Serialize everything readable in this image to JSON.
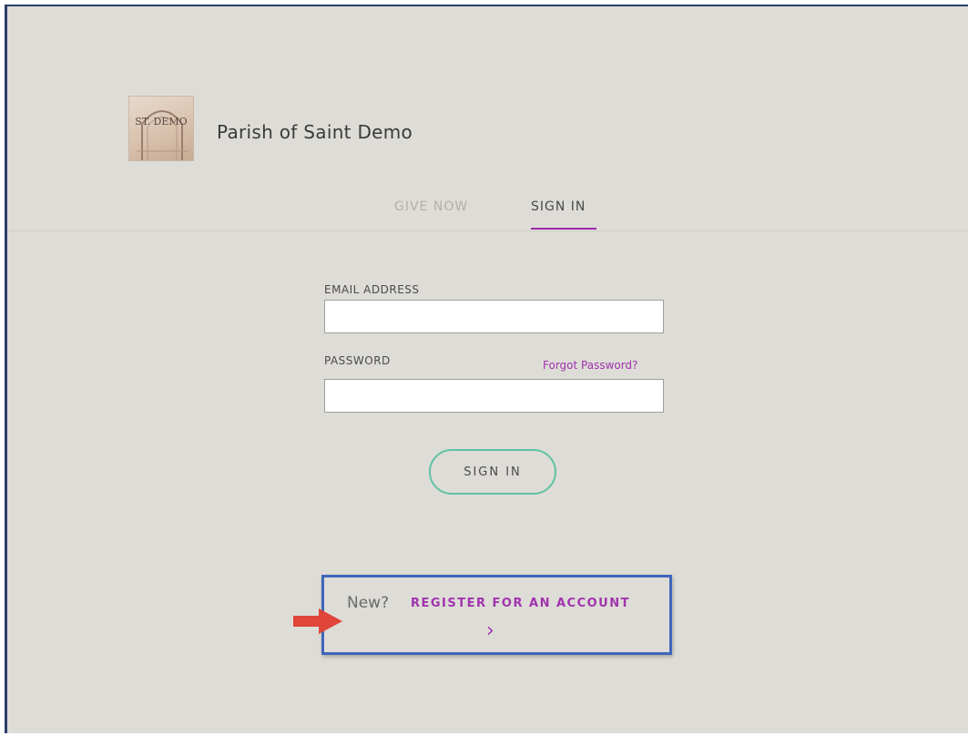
{
  "header": {
    "logo_text": "ST. DEMO",
    "parish_name": "Parish of Saint Demo"
  },
  "tabs": [
    {
      "label": "GIVE NOW",
      "active": false
    },
    {
      "label": "SIGN IN",
      "active": true
    }
  ],
  "form": {
    "email_label": "EMAIL ADDRESS",
    "email_value": "",
    "password_label": "PASSWORD",
    "password_value": "",
    "forgot_link": "Forgot Password?",
    "submit_label": "SIGN IN"
  },
  "register": {
    "prompt": "New?",
    "link_label": "REGISTER FOR AN ACCOUNT",
    "chevron": "›"
  },
  "annotation": {
    "arrow_icon": "red-arrow-right-icon",
    "highlight_color": "#3f66b8",
    "arrow_color": "#e0453a"
  },
  "colors": {
    "accent": "#a033ad",
    "button_border": "#5fc2a6",
    "background": "#dedcd7"
  }
}
